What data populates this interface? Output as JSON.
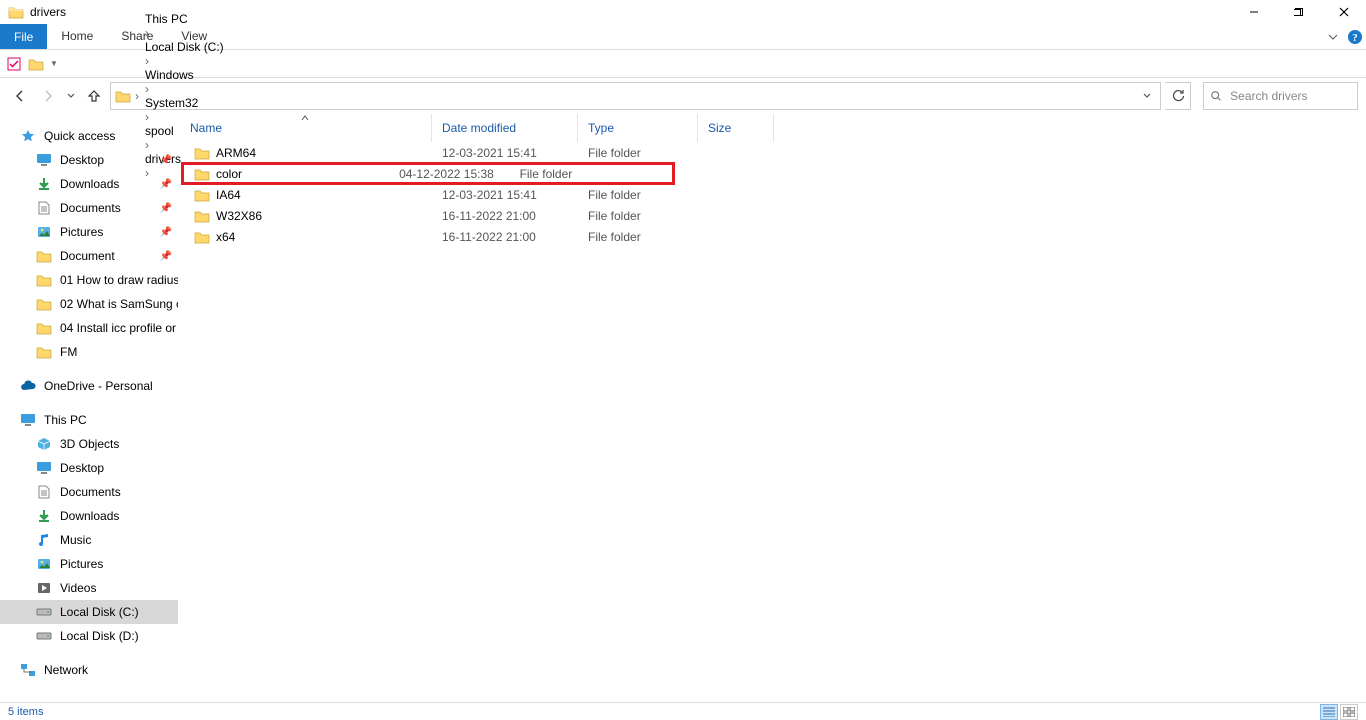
{
  "window": {
    "title": "drivers"
  },
  "ribbon": {
    "file": "File",
    "home": "Home",
    "share": "Share",
    "view": "View"
  },
  "breadcrumbs": [
    "This PC",
    "Local Disk (C:)",
    "Windows",
    "System32",
    "spool",
    "drivers"
  ],
  "search": {
    "placeholder": "Search drivers"
  },
  "columns": {
    "name": "Name",
    "date": "Date modified",
    "type": "Type",
    "size": "Size"
  },
  "rows": [
    {
      "name": "ARM64",
      "date": "12-03-2021 15:41",
      "type": "File folder",
      "size": ""
    },
    {
      "name": "color",
      "date": "04-12-2022 15:38",
      "type": "File folder",
      "size": ""
    },
    {
      "name": "IA64",
      "date": "12-03-2021 15:41",
      "type": "File folder",
      "size": ""
    },
    {
      "name": "W32X86",
      "date": "16-11-2022 21:00",
      "type": "File folder",
      "size": ""
    },
    {
      "name": "x64",
      "date": "16-11-2022 21:00",
      "type": "File folder",
      "size": ""
    }
  ],
  "highlight_index": 1,
  "sidebar": {
    "quick_access": "Quick access",
    "quick_items": [
      {
        "label": "Desktop",
        "icon": "desktop",
        "pinned": true
      },
      {
        "label": "Downloads",
        "icon": "downloads",
        "pinned": true
      },
      {
        "label": "Documents",
        "icon": "documents",
        "pinned": true
      },
      {
        "label": "Pictures",
        "icon": "pictures",
        "pinned": true
      },
      {
        "label": "Document",
        "icon": "folder",
        "pinned": true
      },
      {
        "label": "01 How to draw radius",
        "icon": "folder",
        "pinned": false
      },
      {
        "label": "02 What is SamSung c",
        "icon": "folder",
        "pinned": false
      },
      {
        "label": "04 Install icc profile or",
        "icon": "folder",
        "pinned": false
      },
      {
        "label": "FM",
        "icon": "folder",
        "pinned": false
      }
    ],
    "onedrive": "OneDrive - Personal",
    "this_pc": "This PC",
    "this_pc_items": [
      {
        "label": "3D Objects",
        "icon": "3d"
      },
      {
        "label": "Desktop",
        "icon": "desktop"
      },
      {
        "label": "Documents",
        "icon": "documents"
      },
      {
        "label": "Downloads",
        "icon": "downloads"
      },
      {
        "label": "Music",
        "icon": "music"
      },
      {
        "label": "Pictures",
        "icon": "pictures"
      },
      {
        "label": "Videos",
        "icon": "videos"
      },
      {
        "label": "Local Disk (C:)",
        "icon": "disk",
        "selected": true
      },
      {
        "label": "Local Disk (D:)",
        "icon": "disk"
      }
    ],
    "network": "Network"
  },
  "status": {
    "items": "5 items"
  }
}
